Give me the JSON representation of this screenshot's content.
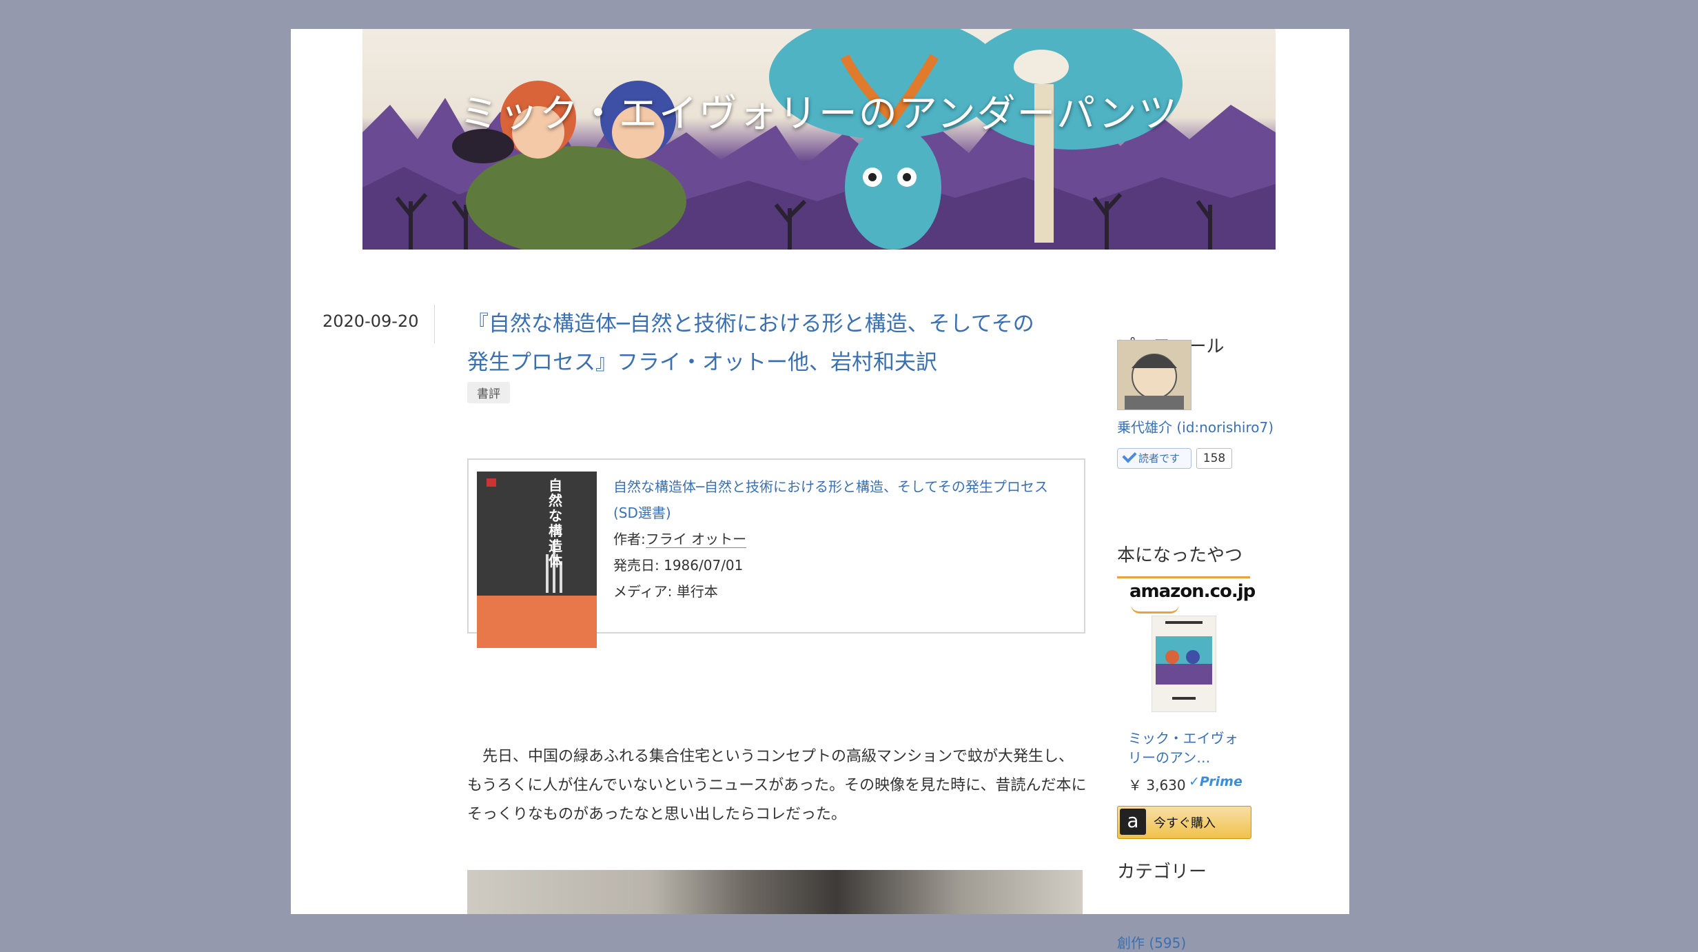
{
  "blog": {
    "title": "ミック・エイヴォリーのアンダーパンツ"
  },
  "entry": {
    "date": "2020-09-20",
    "title": "『自然な構造体─自然と技術における形と構造、そしてその発生プロセス』フライ・オットー他、岩村和夫訳",
    "category": "書評",
    "body": "　先日、中国の緑あふれる集合住宅というコンセプトの高級マンションで蚊が大発生し、もうろくに人が住んでいないというニュースがあった。その映像を見た時に、昔読んだ本にそっくりなものがあったなと思い出したらコレだった。"
  },
  "amazon_item": {
    "cover_text": "自然な構造体",
    "title": "自然な構造体─自然と技術における形と構造、そしてその発生プロセス (SD選書)",
    "author_label": "作者:",
    "author": "フライ オットー",
    "release_label": "発売日:",
    "release": "1986/07/01",
    "media_label": "メディア:",
    "media": "単行本"
  },
  "sidebar": {
    "profile_heading": "プロフィール",
    "profile_name": "乗代雄介 (id:norishiro7)",
    "reader_button": "読者です",
    "reader_count": "158",
    "book_heading": "本になったやつ",
    "amazon_logo": "amazon.co.jp",
    "book_title": "ミック・エイヴォリーのアン…",
    "book_price": "￥ 3,630",
    "prime": "✓Prime",
    "buy_label": "今すぐ購入",
    "category_heading": "カテゴリー",
    "category_first": "創作 (595)"
  },
  "colors": {
    "background": "#9599ae",
    "link": "#3b70b0",
    "amazon_orange": "#f0c14b"
  }
}
